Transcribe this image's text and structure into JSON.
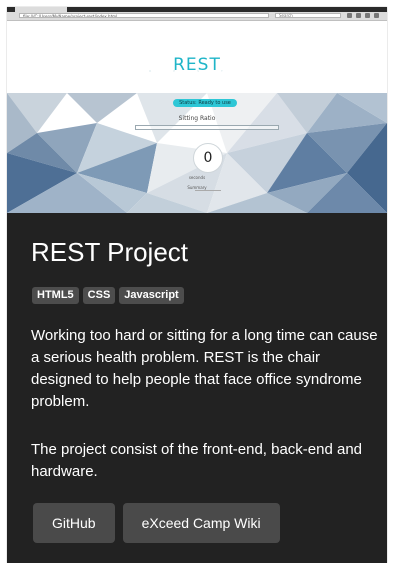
{
  "preview": {
    "url": "file:///C:/Users/MyName/project-rest/index.html",
    "search_placeholder": "Search",
    "app_title": "REST",
    "app_title_ghost": "REST",
    "status": "Status: Ready to use",
    "ratio_label": "Sitting Ratio",
    "timer_value": "0",
    "seconds_label": "seconds",
    "summary_link": "Summary"
  },
  "project": {
    "title": "REST Project",
    "tags": [
      "HTML5",
      "CSS",
      "Javascript"
    ],
    "description": [
      "Working too hard or sitting for a long time can cause a serious health problem. REST is the chair designed to help people that face office syndrome problem.",
      "The project consist of the front-end, back-end and hardware."
    ],
    "buttons": {
      "github": "GitHub",
      "wiki": "eXceed Camp Wiki"
    }
  },
  "colors": {
    "card_background": "#222222",
    "tag_background": "#4d4d4d",
    "button_background": "#4a4a4a",
    "accent": "#1fb5c8"
  }
}
